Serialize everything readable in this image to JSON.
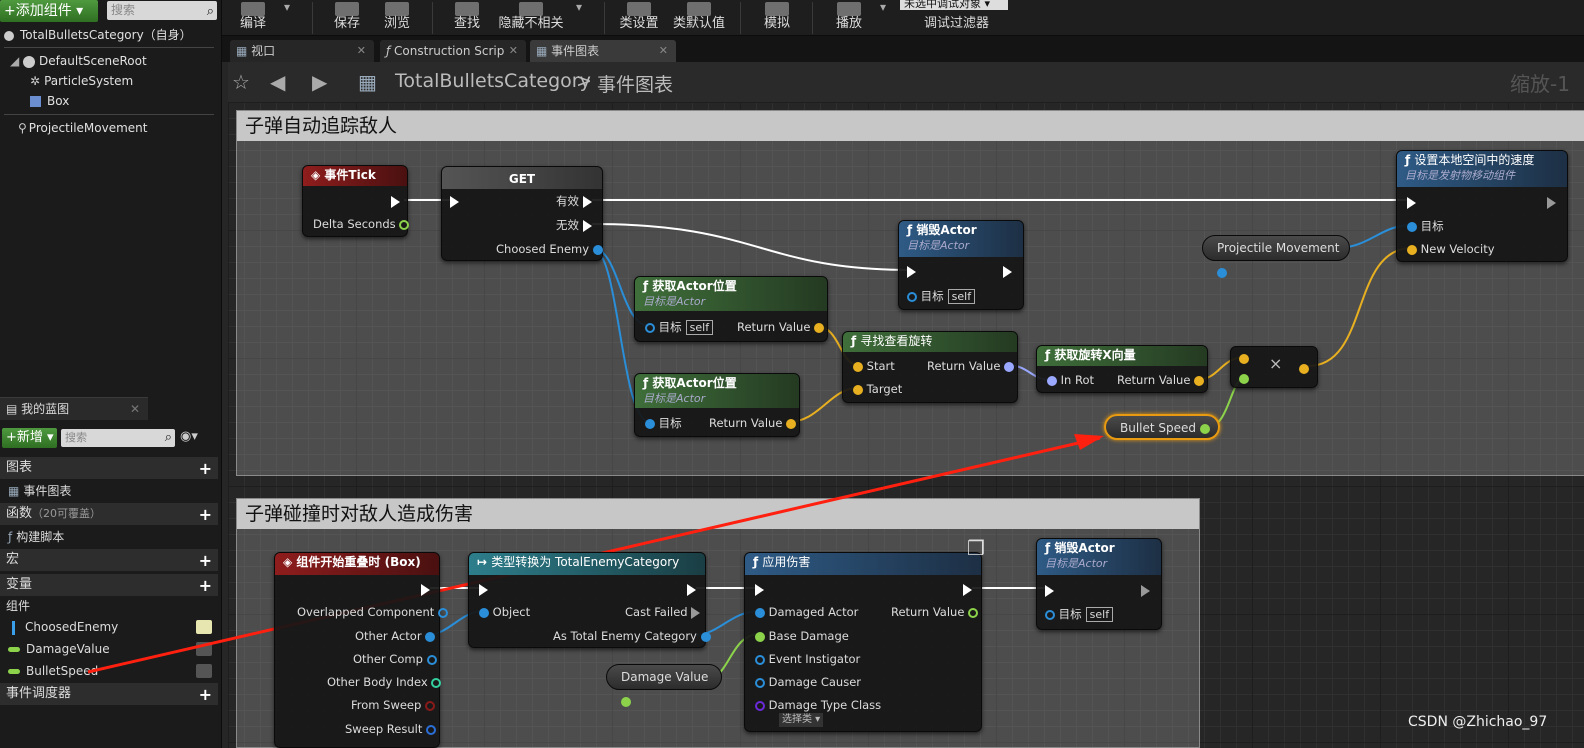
{
  "left": {
    "add_component": "+添加组件 ▾",
    "search_placeholder": "搜索",
    "components": [
      "TotalBulletsCategory（自身）",
      "DefaultSceneRoot",
      "ParticleSystem",
      "Box",
      "ProjectileMovement"
    ],
    "mybp_tab": "我的蓝图",
    "new_button": "+新增 ▾",
    "bp_search_placeholder": "搜索",
    "graphs": "图表",
    "event_graph": "事件图表",
    "functions": "函数",
    "functions_note": "（20可覆盖）",
    "construction_script": "构建脚本",
    "macros": "宏",
    "variables": "变量",
    "components_cat": "组件",
    "vars": [
      "ChoosedEnemy",
      "DamageValue",
      "BulletSpeed"
    ],
    "dispatchers": "事件调度器"
  },
  "toolbar": {
    "compile": "编译",
    "save": "保存",
    "browse": "浏览",
    "find": "查找",
    "hide_unrelated": "隐藏不相关",
    "class_settings": "类设置",
    "class_defaults": "类默认值",
    "simulate": "模拟",
    "play": "播放",
    "debug_object": "未选中调试对象 ▾",
    "debug_filter": "调试过滤器"
  },
  "tabs": [
    "视口",
    "Construction Scrip",
    "事件图表"
  ],
  "breadcrumb": {
    "blueprint": "TotalBulletsCategory",
    "arrow": ">",
    "graph": "事件图表",
    "zoom": "缩放-1"
  },
  "comments": {
    "c1": "子弹自动追踪敌人",
    "c2": "子弹碰撞时对敌人造成伤害"
  },
  "nodes": {
    "tick": {
      "title": "事件Tick",
      "pin": "Delta Seconds"
    },
    "get": {
      "title": "GET",
      "valid": "有效",
      "invalid": "无效",
      "pin": "Choosed Enemy"
    },
    "destroy1": {
      "title": "销毁Actor",
      "sub": "目标是Actor",
      "target": "目标",
      "self": "self"
    },
    "getloc1": {
      "title": "获取Actor位置",
      "sub": "目标是Actor",
      "target": "目标",
      "self": "self",
      "ret": "Return Value"
    },
    "getloc2": {
      "title": "获取Actor位置",
      "sub": "目标是Actor",
      "target": "目标",
      "ret": "Return Value"
    },
    "lookat": {
      "title": "寻找查看旋转",
      "start": "Start",
      "target": "Target",
      "ret": "Return Value"
    },
    "getx": {
      "title": "获取旋转X向量",
      "inrot": "In Rot",
      "ret": "Return Value"
    },
    "mult": {
      "symbol": "×"
    },
    "bulletspeed": "Bullet Speed",
    "projmove": "Projectile Movement",
    "setvel": {
      "title": "设置本地空间中的速度",
      "sub": "目标是发射物移动组件",
      "target": "目标",
      "newvel": "New Velocity"
    },
    "overlap": {
      "title": "组件开始重叠时 (Box)",
      "pins": [
        "Overlapped Component",
        "Other Actor",
        "Other Comp",
        "Other Body Index",
        "From Sweep",
        "Sweep Result"
      ]
    },
    "cast": {
      "title": "类型转换为 TotalEnemyCategory",
      "object": "Object",
      "failed": "Cast Failed",
      "as": "As Total Enemy Category"
    },
    "damage": {
      "title": "应用伤害",
      "pins": [
        "Damaged Actor",
        "Base Damage",
        "Event Instigator",
        "Damage Causer",
        "Damage Type Class"
      ],
      "ret": "Return Value",
      "select": "选择类 ▾"
    },
    "damagevalue": "Damage Value",
    "destroy2": {
      "title": "销毁Actor",
      "sub": "目标是Actor",
      "target": "目标",
      "self": "self"
    }
  },
  "watermark": "CSDN @Zhichao_97"
}
